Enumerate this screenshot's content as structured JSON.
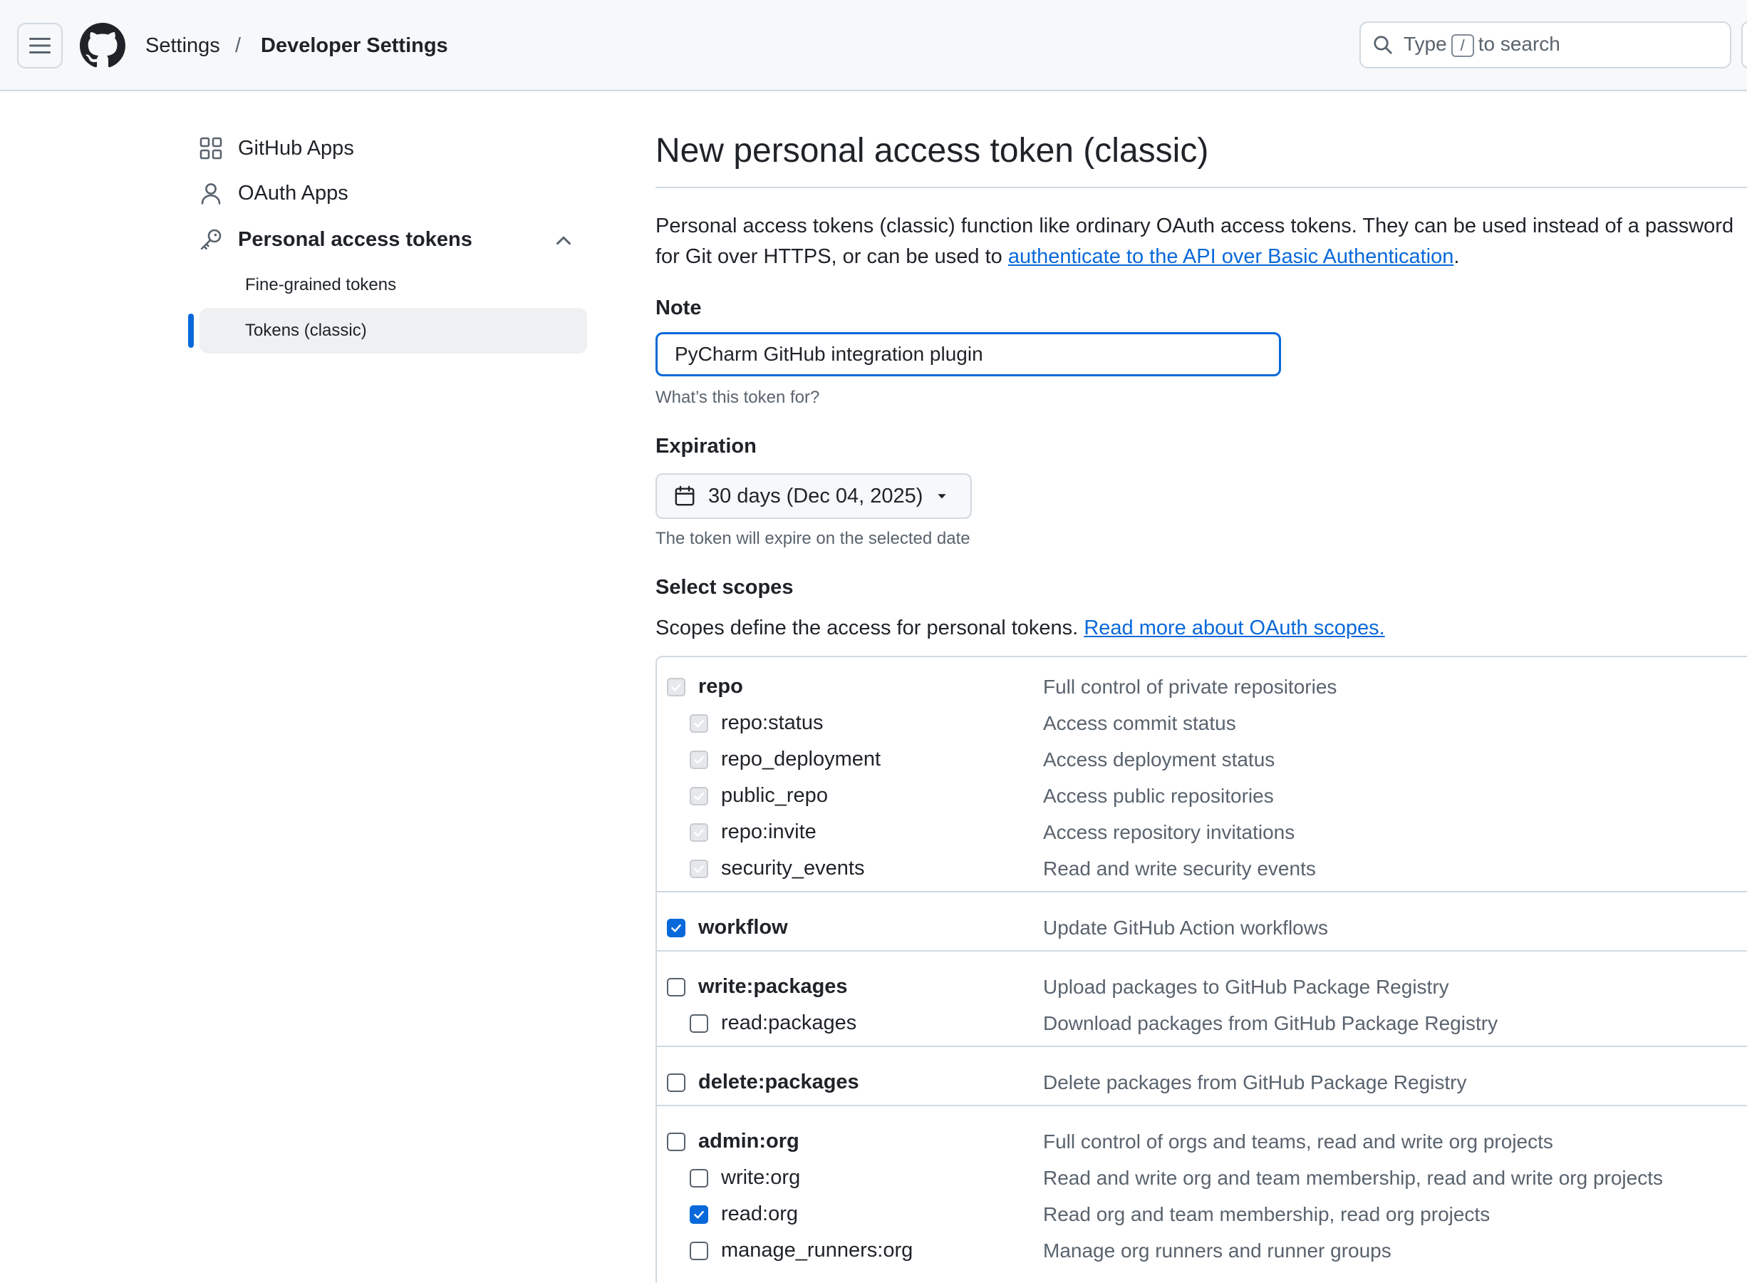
{
  "header": {
    "breadcrumb_settings": "Settings",
    "breadcrumb_separator": "/",
    "breadcrumb_current": "Developer Settings",
    "search_prefix": "Type",
    "search_key": "/",
    "search_suffix": "to search"
  },
  "sidebar": {
    "github_apps": "GitHub Apps",
    "oauth_apps": "OAuth Apps",
    "personal_tokens": "Personal access tokens",
    "fine_grained": "Fine-grained tokens",
    "tokens_classic": "Tokens (classic)"
  },
  "main": {
    "title": "New personal access token (classic)",
    "intro_text": "Personal access tokens (classic) function like ordinary OAuth access tokens. They can be used instead of a password for Git over HTTPS, or can be used to",
    "intro_link": "authenticate to the API over Basic Authentication",
    "intro_end": ".",
    "note_label": "Note",
    "note_value": "PyCharm GitHub integration plugin",
    "note_hint": "What’s this token for?",
    "expiration_label": "Expiration",
    "expiration_value": "30 days (Dec 04, 2025)",
    "expiration_hint": "The token will expire on the selected date",
    "scopes_label": "Select scopes",
    "scopes_text": "Scopes define the access for personal tokens.",
    "scopes_link": "Read more about OAuth scopes."
  },
  "scopes": [
    {
      "name": "repo",
      "desc": "Full control of private repositories",
      "state": "disabled",
      "top": true
    },
    {
      "name": "repo:status",
      "desc": "Access commit status",
      "state": "disabled",
      "top": false
    },
    {
      "name": "repo_deployment",
      "desc": "Access deployment status",
      "state": "disabled",
      "top": false
    },
    {
      "name": "public_repo",
      "desc": "Access public repositories",
      "state": "disabled",
      "top": false
    },
    {
      "name": "repo:invite",
      "desc": "Access repository invitations",
      "state": "disabled",
      "top": false
    },
    {
      "name": "security_events",
      "desc": "Read and write security events",
      "state": "disabled",
      "top": false
    },
    {
      "name": "workflow",
      "desc": "Update GitHub Action workflows",
      "state": "checked",
      "top": true
    },
    {
      "name": "write:packages",
      "desc": "Upload packages to GitHub Package Registry",
      "state": "unchecked",
      "top": true
    },
    {
      "name": "read:packages",
      "desc": "Download packages from GitHub Package Registry",
      "state": "unchecked",
      "top": false
    },
    {
      "name": "delete:packages",
      "desc": "Delete packages from GitHub Package Registry",
      "state": "unchecked",
      "top": true
    },
    {
      "name": "admin:org",
      "desc": "Full control of orgs and teams, read and write org projects",
      "state": "unchecked",
      "top": true
    },
    {
      "name": "write:org",
      "desc": "Read and write org and team membership, read and write org projects",
      "state": "unchecked",
      "top": false
    },
    {
      "name": "read:org",
      "desc": "Read org and team membership, read org projects",
      "state": "checked",
      "top": false
    },
    {
      "name": "manage_runners:org",
      "desc": "Manage org runners and runner groups",
      "state": "unchecked",
      "top": false
    }
  ],
  "colors": {
    "accent": "#0969da",
    "header_bg": "#f6f8fa",
    "border": "#d1d9e0",
    "muted_text": "#59636e"
  }
}
